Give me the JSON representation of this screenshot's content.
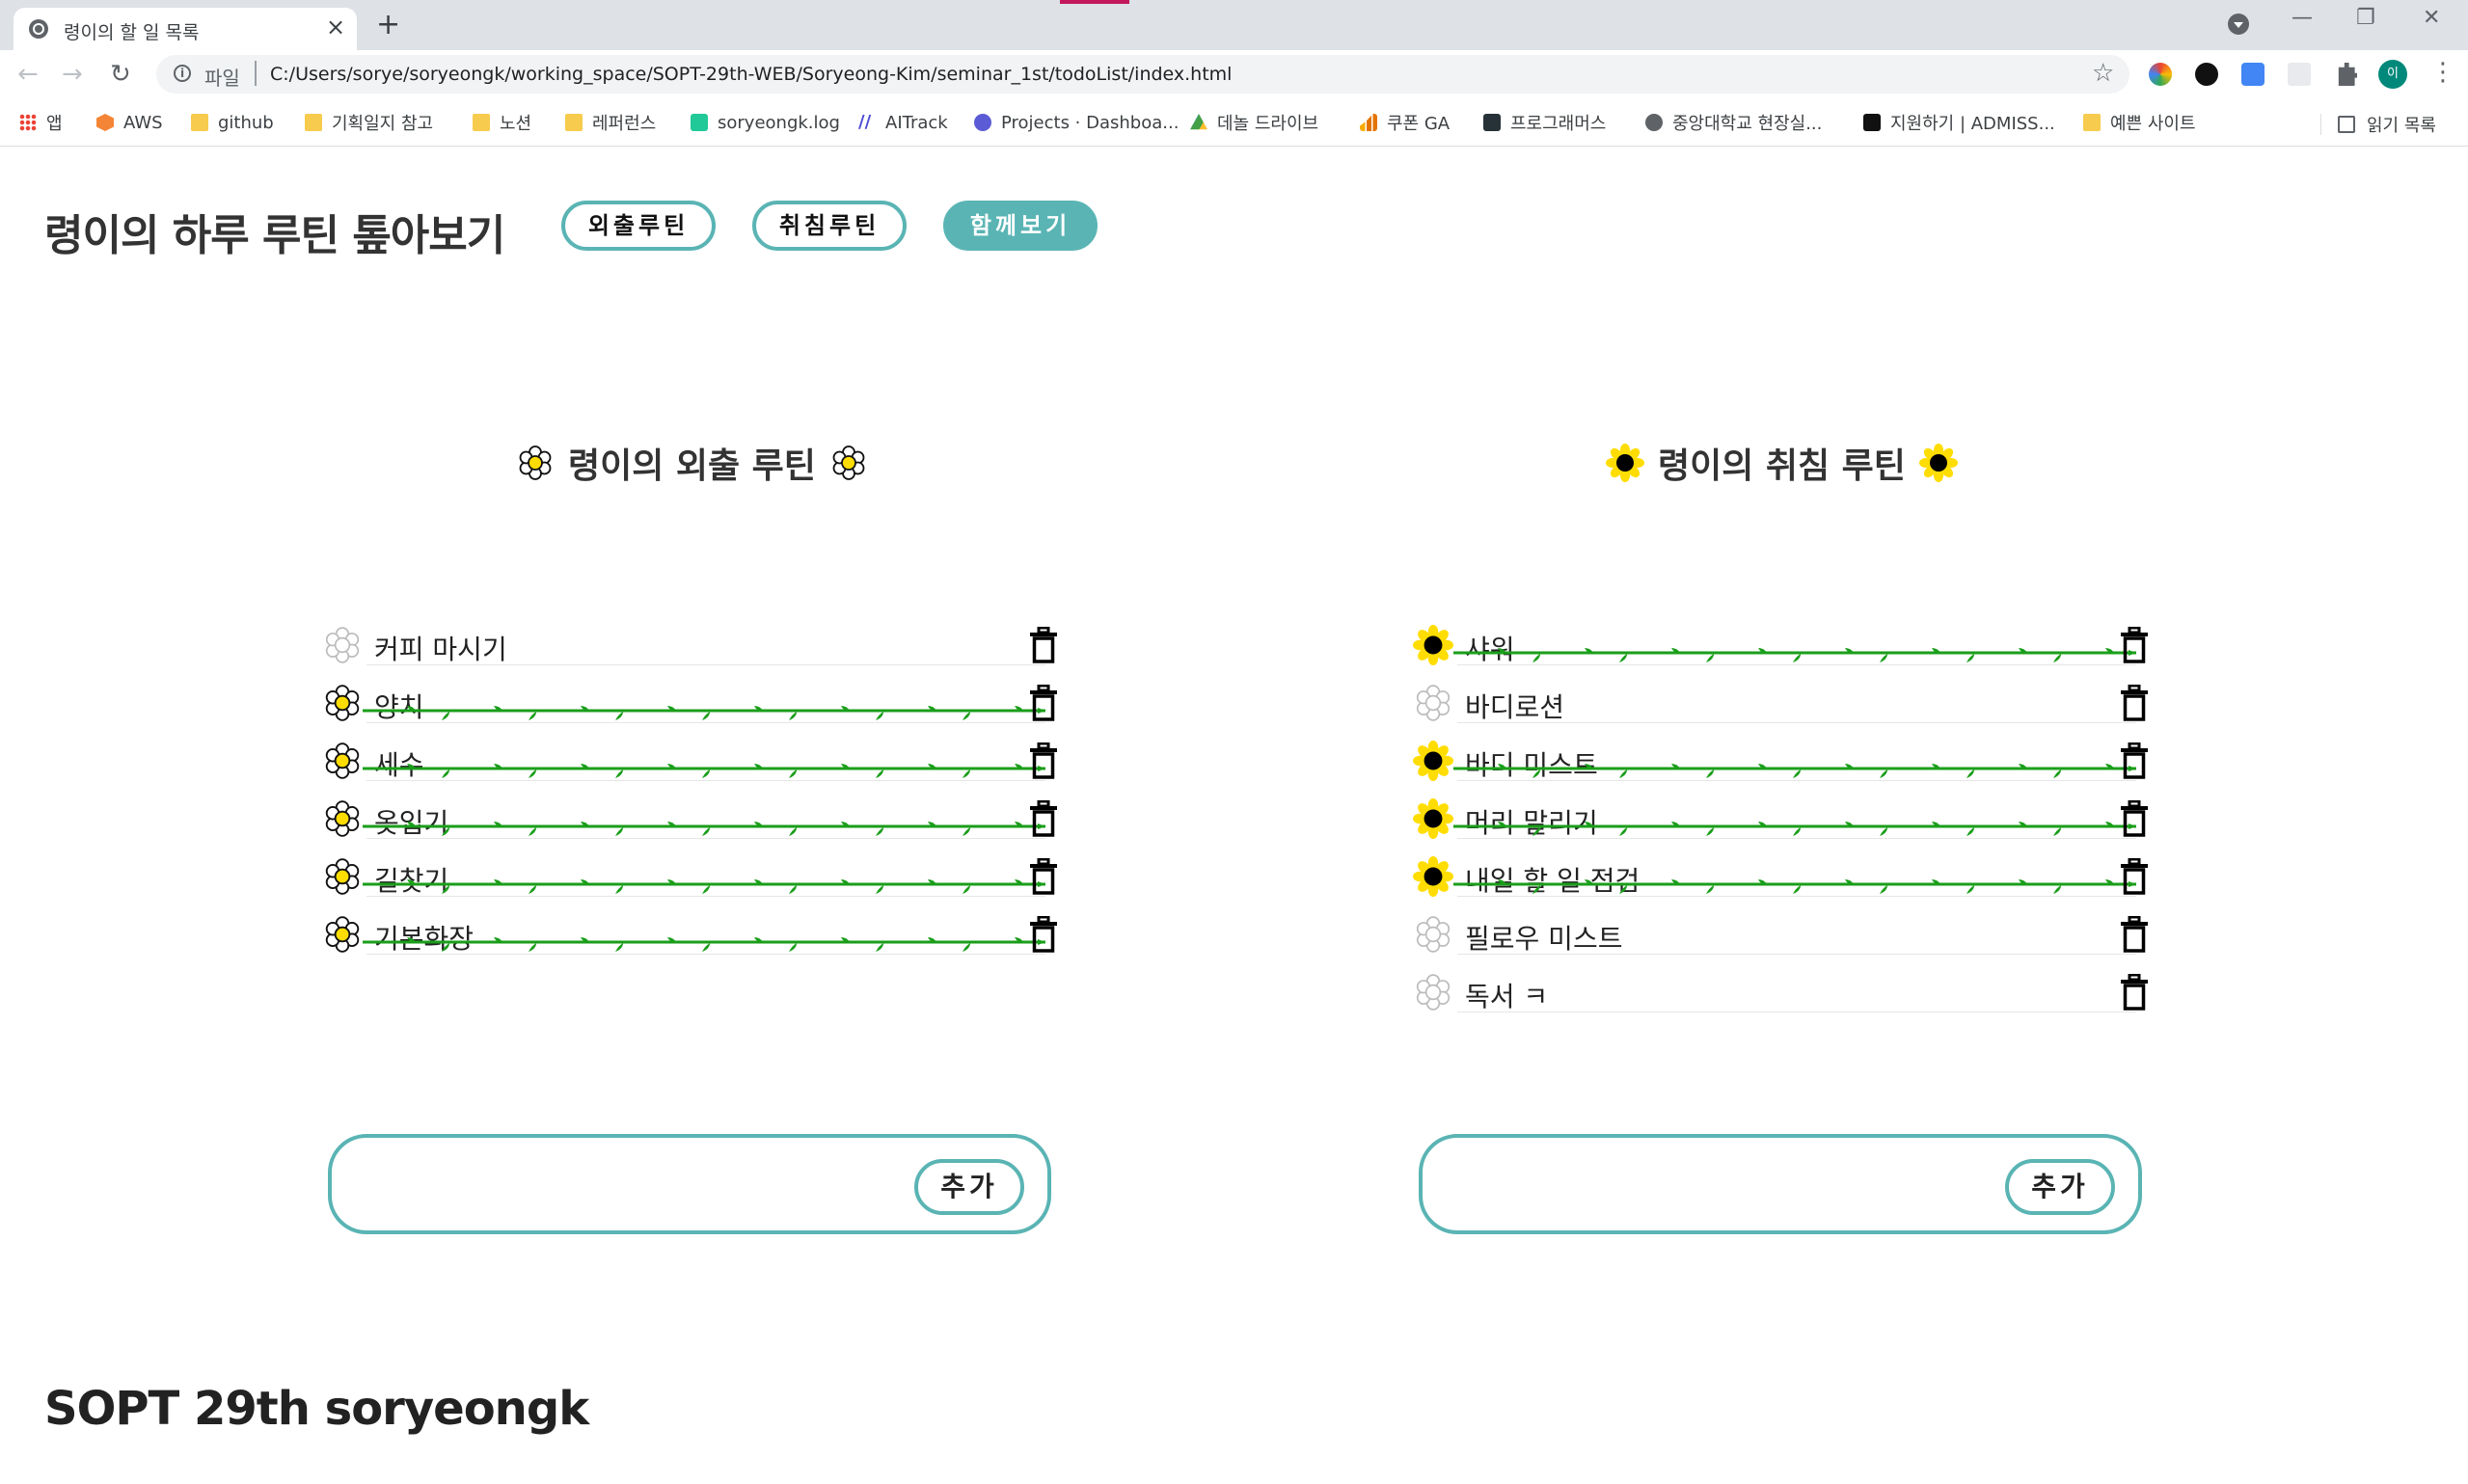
{
  "browser": {
    "tab_title": "령이의 할 일 목록",
    "tab_close": "×",
    "new_tab": "+",
    "window_controls": [
      "—",
      "❐",
      "✕"
    ],
    "url_scheme": "파일",
    "url": "C:/Users/sorye/soryeongk/working_space/SOPT-29th-WEB/Soryeong-Kim/seminar_1st/todoList/index.html",
    "profile_initial": "이",
    "reading_list": "읽기 목록",
    "bookmarks": [
      {
        "label": "앱",
        "icon": "apps-icon"
      },
      {
        "label": "AWS",
        "icon": "aws-icon"
      },
      {
        "label": "github",
        "icon": "folder-icon"
      },
      {
        "label": "기획일지 참고",
        "icon": "folder-icon"
      },
      {
        "label": "노션",
        "icon": "folder-icon"
      },
      {
        "label": "레퍼런스",
        "icon": "folder-icon"
      },
      {
        "label": "soryeongk.log",
        "icon": "velog-icon"
      },
      {
        "label": "AITrack",
        "icon": "aitrack-icon"
      },
      {
        "label": "Projects · Dashboa...",
        "icon": "projects-icon"
      },
      {
        "label": "데놀 드라이브",
        "icon": "drive-icon"
      },
      {
        "label": "쿠폰 GA",
        "icon": "analytics-icon"
      },
      {
        "label": "프로그래머스",
        "icon": "programmers-icon"
      },
      {
        "label": "중앙대학교 현장실...",
        "icon": "globe-icon"
      },
      {
        "label": "지원하기 | ADMISS...",
        "icon": "admiss-icon"
      },
      {
        "label": "예쁜 사이트",
        "icon": "folder-icon"
      }
    ]
  },
  "header": {
    "title": "령이의 하루 루틴 톺아보기",
    "buttons": [
      {
        "label": "외출루틴",
        "active": false
      },
      {
        "label": "취침루틴",
        "active": false
      },
      {
        "label": "함께보기",
        "active": true
      }
    ]
  },
  "colors": {
    "accent": "#5ab4b4",
    "vine": "#1a9e1a",
    "flower_yellow": "#ffdd00"
  },
  "outing": {
    "title": "령이의 외출 루틴",
    "title_icon": "daisy-flower-icon",
    "items": [
      {
        "text": "커피 마시기",
        "done": false
      },
      {
        "text": "양치",
        "done": true
      },
      {
        "text": "세수",
        "done": true
      },
      {
        "text": "옷입기",
        "done": true
      },
      {
        "text": "길찾기",
        "done": true
      },
      {
        "text": "기본화장",
        "done": true
      }
    ],
    "input_placeholder": "",
    "add_label": "추가"
  },
  "sleep": {
    "title": "령이의 취침 루틴",
    "title_icon": "sunflower-icon",
    "items": [
      {
        "text": "샤워",
        "done": true
      },
      {
        "text": "바디로션",
        "done": false
      },
      {
        "text": "바디 미스트",
        "done": true
      },
      {
        "text": "머리 말리기",
        "done": true
      },
      {
        "text": "내일 할 일 점검",
        "done": true
      },
      {
        "text": "필로우 미스트",
        "done": false
      },
      {
        "text": "독서 ㅋ",
        "done": false
      }
    ],
    "input_placeholder": "",
    "add_label": "추가"
  },
  "footer": {
    "text": "SOPT 29th soryeongk"
  }
}
